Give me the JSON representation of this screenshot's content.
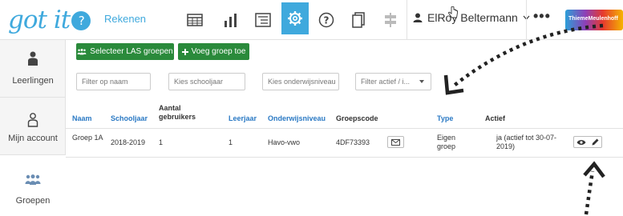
{
  "header": {
    "logo_text": "got it",
    "logo_badge": "?",
    "section": "Rekenen",
    "user_name": "ElRoy Beltermann",
    "more_label": "•••",
    "brand_text": "ThiemeMeulenhoff"
  },
  "nav_icons": [
    "table-icon",
    "bar-chart-icon",
    "list-icon",
    "settings-icon",
    "help-icon",
    "copy-icon",
    "signpost-icon"
  ],
  "sidebar": {
    "items": [
      {
        "label": "Leerlingen",
        "icon": "student-icon"
      },
      {
        "label": "Mijn account",
        "icon": "account-icon"
      },
      {
        "label": "Groepen",
        "icon": "groups-icon"
      }
    ]
  },
  "actions": {
    "select_las": "Selecteer LAS groepen",
    "add_group": "Voeg groep toe"
  },
  "filters": {
    "name": "Filter op naam",
    "year": "Kies schooljaar",
    "level": "Kies onderwijsniveau",
    "active": "Filter actief / i..."
  },
  "table": {
    "headers": {
      "name": "Naam",
      "year": "Schooljaar",
      "users": "Aantal gebruikers",
      "grade": "Leerjaar",
      "level": "Onderwijsniveau",
      "code": "Groepscode",
      "type": "Type",
      "active": "Actief"
    },
    "rows": [
      {
        "name": "Groep 1A",
        "year": "2018-2019",
        "users": "1",
        "grade": "1",
        "level": "Havo-vwo",
        "code": "4DF73393",
        "type": "Eigen groep",
        "active": "ja (actief tot 30-07-2019)"
      }
    ]
  }
}
